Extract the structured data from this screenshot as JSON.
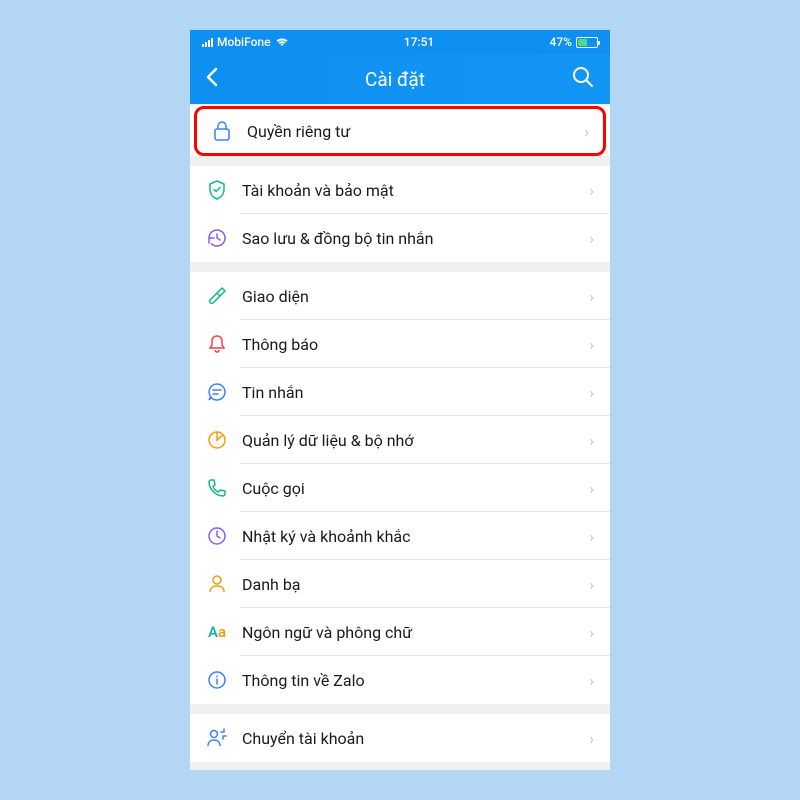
{
  "statusBar": {
    "carrier": "MobiFone",
    "time": "17:51",
    "battery": "47%"
  },
  "navBar": {
    "title": "Cài đặt"
  },
  "sections": [
    {
      "items": [
        {
          "label": "Quyền riêng tư",
          "highlighted": true
        }
      ]
    },
    {
      "items": [
        {
          "label": "Tài khoản và bảo mật"
        },
        {
          "label": "Sao lưu & đồng bộ tin nhắn"
        }
      ]
    },
    {
      "items": [
        {
          "label": "Giao diện"
        },
        {
          "label": "Thông báo"
        },
        {
          "label": "Tin nhắn"
        },
        {
          "label": "Quản lý dữ liệu & bộ nhớ"
        },
        {
          "label": "Cuộc gọi"
        },
        {
          "label": "Nhật ký và khoảnh khắc"
        },
        {
          "label": "Danh bạ"
        },
        {
          "label": "Ngôn ngữ và phông chữ"
        },
        {
          "label": "Thông tin về Zalo"
        }
      ]
    },
    {
      "items": [
        {
          "label": "Chuyển tài khoản"
        }
      ]
    }
  ]
}
